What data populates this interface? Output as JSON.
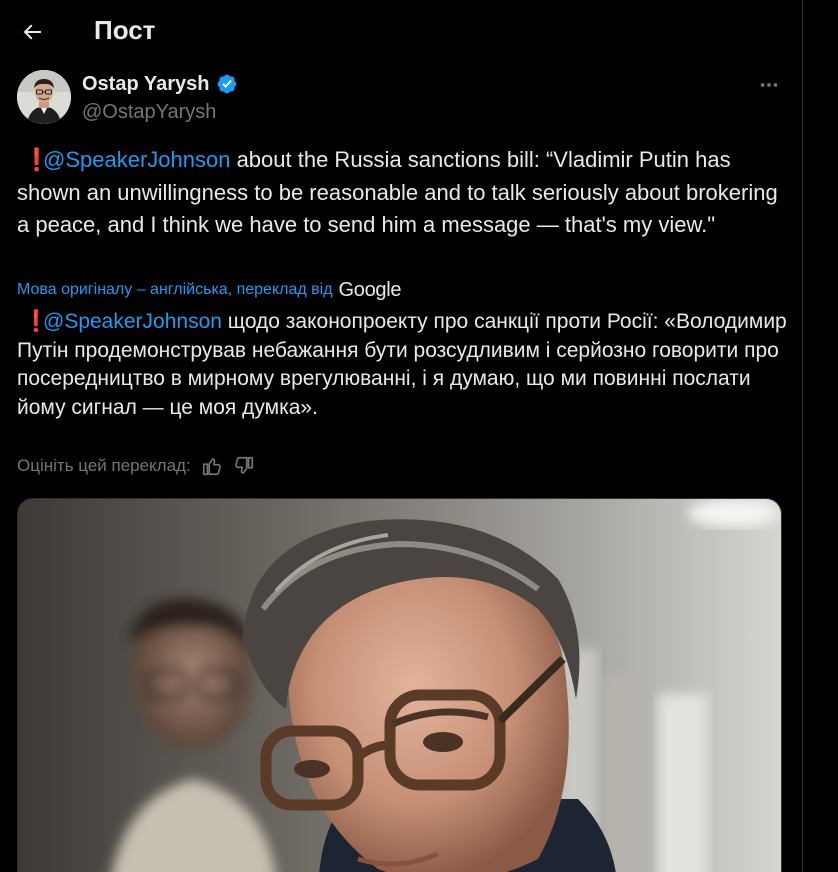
{
  "header": {
    "title": "Пост",
    "back_icon": "arrow-left-icon"
  },
  "author": {
    "name": "Ostap Yarysh",
    "handle": "@OstapYarysh",
    "verified_icon": "verified-badge-icon",
    "verified_color": "#1d9bf0"
  },
  "tweet": {
    "exclamation": "❗",
    "mention": "@SpeakerJohnson",
    "text": " about the Russia sanctions bill: “Vladimir Putin has shown an unwillingness to be reasonable and to talk seriously about brokering a peace, and I think we have to send him a message — that's my view.\""
  },
  "translation": {
    "note": "Мова оригіналу – англійська, переклад від",
    "provider": "Google",
    "exclamation": "❗",
    "mention": "@SpeakerJohnson",
    "text": " щодо законопроекту про санкції проти Росії: «Володимир Путін продемонстрував небажання бути розсудливим і серйозно говорити про посередництво в мирному врегулюванні, і я думаю, що ми повинні послати йому сигнал — це моя думка»."
  },
  "rating": {
    "label": "Оцініть цей переклад:",
    "like_icon": "thumbs-up-icon",
    "dislike_icon": "thumbs-down-icon"
  },
  "colors": {
    "background": "#000000",
    "text": "#e7e9ea",
    "secondary": "#71767b",
    "link": "#1d9bf0",
    "border": "#2f3336"
  }
}
